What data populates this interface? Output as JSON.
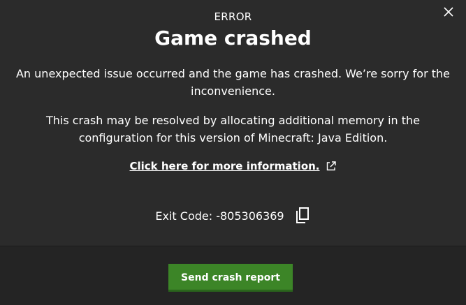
{
  "dialog": {
    "eyebrow": "ERROR",
    "title": "Game crashed",
    "message_1": "An unexpected issue occurred and the game has crashed. We’re sorry for the inconvenience.",
    "message_2": "This crash may be resolved by allocating additional memory in the configuration for this version of Minecraft: Java Edition.",
    "info_link": "Click here for more information.",
    "exit_code_label": "Exit Code: -805306369",
    "send_button": "Send crash report"
  },
  "colors": {
    "background": "#2b2b2b",
    "footer": "#242424",
    "button_green": "#3c8527",
    "text": "#ffffff"
  },
  "icons": {
    "close": "close-icon",
    "external_link": "external-link-icon",
    "copy": "copy-icon"
  }
}
